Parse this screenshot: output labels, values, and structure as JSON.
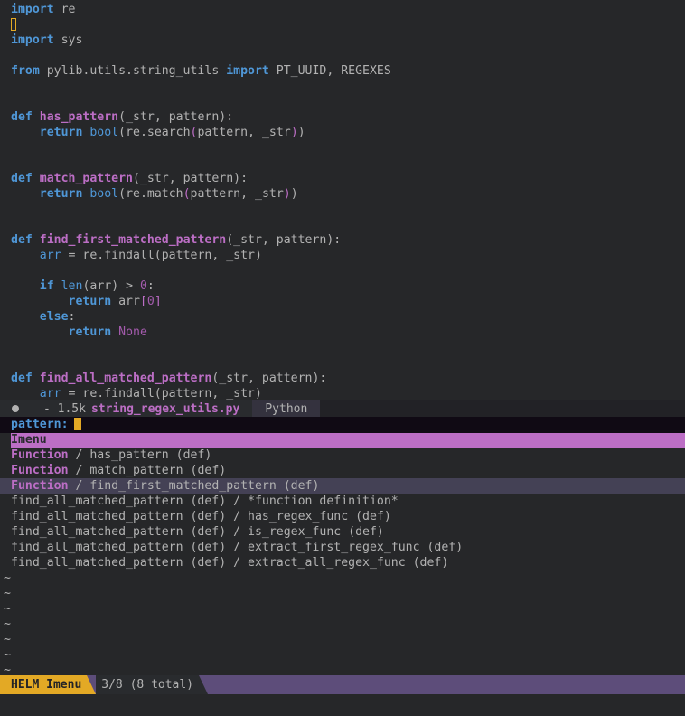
{
  "editor": {
    "lines": [
      [
        {
          "c": "kw",
          "t": "import"
        },
        {
          "c": "plain",
          "t": " re"
        }
      ],
      [
        {
          "c": "cursor",
          "t": ""
        }
      ],
      [
        {
          "c": "kw",
          "t": "import"
        },
        {
          "c": "plain",
          "t": " sys"
        }
      ],
      [],
      [
        {
          "c": "kw",
          "t": "from"
        },
        {
          "c": "plain",
          "t": " pylib.utils.string_utils "
        },
        {
          "c": "kw",
          "t": "import"
        },
        {
          "c": "plain",
          "t": " PT_UUID, REGEXES"
        }
      ],
      [],
      [],
      [
        {
          "c": "kw",
          "t": "def"
        },
        {
          "c": "plain",
          "t": " "
        },
        {
          "c": "fn",
          "t": "has_pattern"
        },
        {
          "c": "plain",
          "t": "(_str, pattern):"
        }
      ],
      [
        {
          "c": "plain",
          "t": "    "
        },
        {
          "c": "kw",
          "t": "return"
        },
        {
          "c": "plain",
          "t": " "
        },
        {
          "c": "bi",
          "t": "bool"
        },
        {
          "c": "plain",
          "t": "(re.search"
        },
        {
          "c": "paren",
          "t": "("
        },
        {
          "c": "plain",
          "t": "pattern, _str"
        },
        {
          "c": "paren",
          "t": ")"
        },
        {
          "c": "plain",
          "t": ")"
        }
      ],
      [],
      [],
      [
        {
          "c": "kw",
          "t": "def"
        },
        {
          "c": "plain",
          "t": " "
        },
        {
          "c": "fn",
          "t": "match_pattern"
        },
        {
          "c": "plain",
          "t": "(_str, pattern):"
        }
      ],
      [
        {
          "c": "plain",
          "t": "    "
        },
        {
          "c": "kw",
          "t": "return"
        },
        {
          "c": "plain",
          "t": " "
        },
        {
          "c": "bi",
          "t": "bool"
        },
        {
          "c": "plain",
          "t": "(re.match"
        },
        {
          "c": "paren",
          "t": "("
        },
        {
          "c": "plain",
          "t": "pattern, _str"
        },
        {
          "c": "paren",
          "t": ")"
        },
        {
          "c": "plain",
          "t": ")"
        }
      ],
      [],
      [],
      [
        {
          "c": "kw",
          "t": "def"
        },
        {
          "c": "plain",
          "t": " "
        },
        {
          "c": "fn",
          "t": "find_first_matched_pattern"
        },
        {
          "c": "plain",
          "t": "(_str, pattern):"
        }
      ],
      [
        {
          "c": "plain",
          "t": "    "
        },
        {
          "c": "bi",
          "t": "arr"
        },
        {
          "c": "plain",
          "t": " = re.findall(pattern, _str)"
        }
      ],
      [],
      [
        {
          "c": "plain",
          "t": "    "
        },
        {
          "c": "kw",
          "t": "if"
        },
        {
          "c": "plain",
          "t": " "
        },
        {
          "c": "bi",
          "t": "len"
        },
        {
          "c": "plain",
          "t": "(arr) > "
        },
        {
          "c": "num",
          "t": "0"
        },
        {
          "c": "plain",
          "t": ":"
        }
      ],
      [
        {
          "c": "plain",
          "t": "        "
        },
        {
          "c": "kw",
          "t": "return"
        },
        {
          "c": "plain",
          "t": " arr"
        },
        {
          "c": "paren",
          "t": "["
        },
        {
          "c": "num",
          "t": "0"
        },
        {
          "c": "paren",
          "t": "]"
        }
      ],
      [
        {
          "c": "plain",
          "t": "    "
        },
        {
          "c": "kw",
          "t": "else"
        },
        {
          "c": "plain",
          "t": ":"
        }
      ],
      [
        {
          "c": "plain",
          "t": "        "
        },
        {
          "c": "kw",
          "t": "return"
        },
        {
          "c": "plain",
          "t": " "
        },
        {
          "c": "const",
          "t": "None"
        }
      ],
      [],
      [],
      [
        {
          "c": "kw",
          "t": "def"
        },
        {
          "c": "plain",
          "t": " "
        },
        {
          "c": "fn",
          "t": "find_all_matched_pattern"
        },
        {
          "c": "plain",
          "t": "(_str, pattern):"
        }
      ],
      [
        {
          "c": "plain",
          "t": "    "
        },
        {
          "c": "bi",
          "t": "arr"
        },
        {
          "c": "plain",
          "t": " = re.findall(pattern, _str)"
        }
      ]
    ]
  },
  "editor_modeline": {
    "size": "- 1.5k",
    "filename": "string_regex_utils.py",
    "mode": "Python"
  },
  "helm": {
    "prompt": "pattern:",
    "source_header": "Imenu",
    "candidates": [
      {
        "cat": "Function",
        "rest": " / has_pattern (def)",
        "selected": false
      },
      {
        "cat": "Function",
        "rest": " / match_pattern (def)",
        "selected": false
      },
      {
        "cat": "Function",
        "rest": " / find_first_matched_pattern (def)",
        "selected": true
      },
      {
        "cat": "",
        "rest": "find_all_matched_pattern (def) / *function definition*",
        "selected": false
      },
      {
        "cat": "",
        "rest": "find_all_matched_pattern (def) / has_regex_func (def)",
        "selected": false
      },
      {
        "cat": "",
        "rest": "find_all_matched_pattern (def) / is_regex_func (def)",
        "selected": false
      },
      {
        "cat": "",
        "rest": "find_all_matched_pattern (def) / extract_first_regex_func (def)",
        "selected": false
      },
      {
        "cat": "",
        "rest": "find_all_matched_pattern (def) / extract_all_regex_func (def)",
        "selected": false
      }
    ],
    "tildes": [
      "~",
      "~",
      "~",
      "~",
      "~",
      "~",
      "~"
    ]
  },
  "helm_modeline": {
    "name": "HELM Imenu",
    "count": "3/8 (8 total)"
  },
  "colors": {
    "keyword": "#4f97d7",
    "function": "#bc6ec5",
    "background": "#262729",
    "cursor": "#e3a925",
    "modeline": "#5d4d7a"
  }
}
